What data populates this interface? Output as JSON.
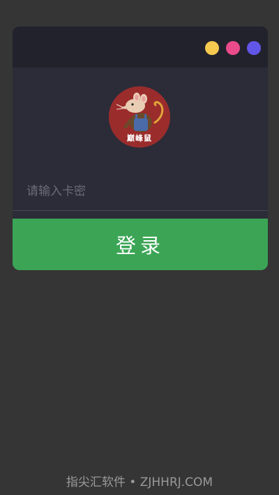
{
  "window_controls": [
    {
      "name": "minimize",
      "color": "#f6c94f"
    },
    {
      "name": "maximize",
      "color": "#ec4b8b"
    },
    {
      "name": "close",
      "color": "#6256e8"
    }
  ],
  "logo": {
    "icon": "rat-mascot-icon",
    "text": "巅峰鼠",
    "background": "#9b2c2c"
  },
  "card_input": {
    "placeholder": "请输入卡密",
    "value": ""
  },
  "login_button": {
    "label": "登录",
    "color": "#3ba555"
  },
  "footer": {
    "text": "指尖汇软件 • ZJHHRJ.COM"
  }
}
